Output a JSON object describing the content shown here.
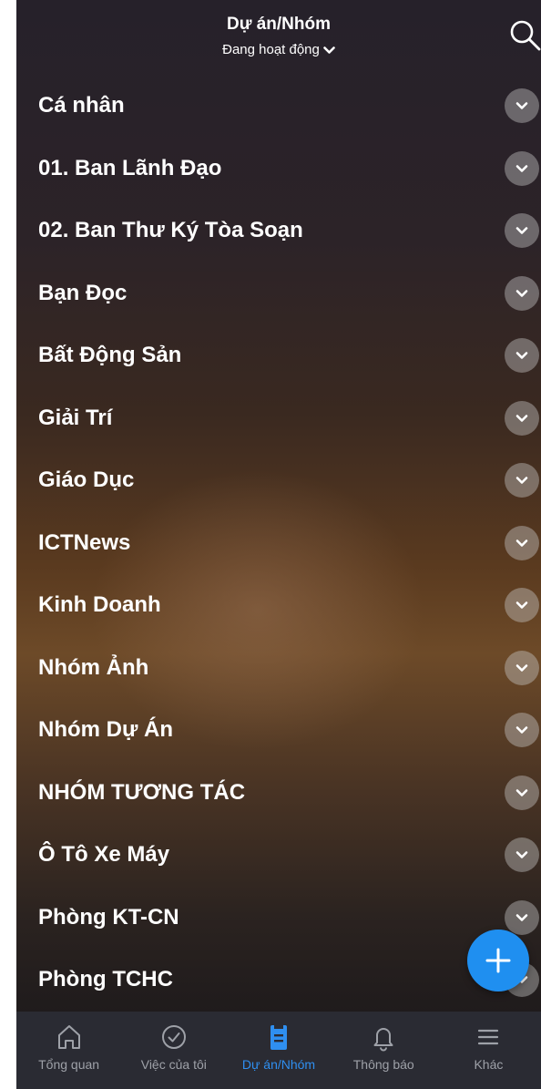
{
  "header": {
    "title": "Dự án/Nhóm",
    "status_filter": "Đang hoạt động"
  },
  "groups": [
    {
      "label": "Cá nhân"
    },
    {
      "label": "01. Ban Lãnh Đạo"
    },
    {
      "label": "02. Ban Thư Ký Tòa Soạn"
    },
    {
      "label": "Bạn Đọc"
    },
    {
      "label": "Bất Động Sản"
    },
    {
      "label": "Giải Trí"
    },
    {
      "label": "Giáo Dục"
    },
    {
      "label": "ICTNews"
    },
    {
      "label": "Kinh Doanh"
    },
    {
      "label": "Nhóm Ảnh"
    },
    {
      "label": "Nhóm Dự Án"
    },
    {
      "label": "NHÓM TƯƠNG TÁC"
    },
    {
      "label": "Ô Tô Xe Máy"
    },
    {
      "label": "Phòng KT-CN"
    },
    {
      "label": "Phòng TCHC"
    }
  ],
  "tabs": [
    {
      "label": "Tổng quan",
      "icon": "home-icon"
    },
    {
      "label": "Việc của tôi",
      "icon": "check-circle-icon"
    },
    {
      "label": "Dự án/Nhóm",
      "icon": "clipboard-icon",
      "active": true
    },
    {
      "label": "Thông báo",
      "icon": "bell-icon"
    },
    {
      "label": "Khác",
      "icon": "menu-icon"
    }
  ],
  "colors": {
    "accent": "#2f8ff0",
    "tabbar_bg": "#2a2b33",
    "tab_inactive": "#9ea1a8"
  }
}
